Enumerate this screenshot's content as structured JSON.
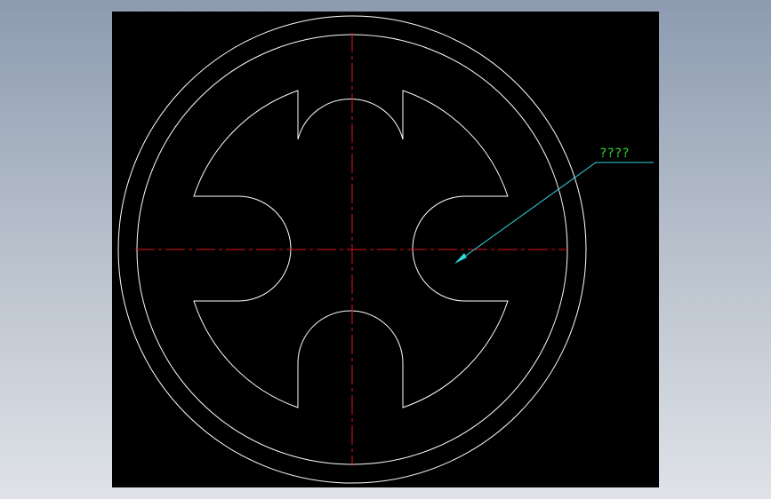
{
  "drawing": {
    "annotation": {
      "text": "????",
      "text_color": "#2fd62f",
      "leader_color": "#33d6dd"
    },
    "colors": {
      "background": "#000000",
      "outline": "#ffffff",
      "centerline": "#e0101c"
    }
  }
}
